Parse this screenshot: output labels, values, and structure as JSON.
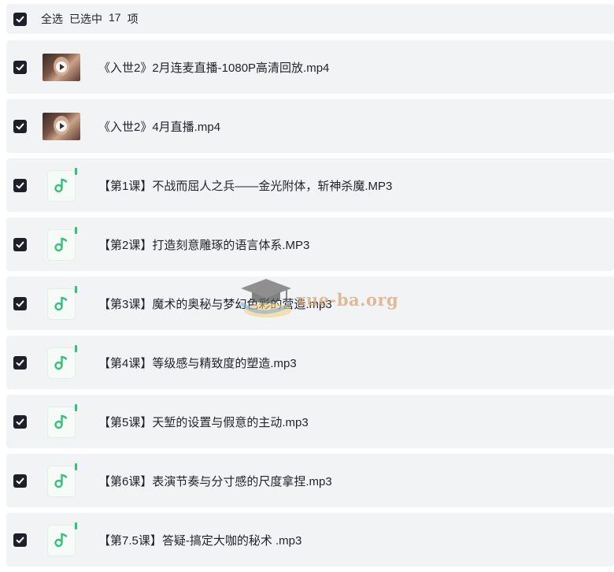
{
  "header": {
    "select_all": "全选",
    "selected_prefix": "已选中",
    "selected_count": "17",
    "selected_suffix": "项"
  },
  "items": [
    {
      "type": "video",
      "icon": "video-thumbnail",
      "title": "《入世2》2月连麦直播-1080P高清回放.mp4"
    },
    {
      "type": "video",
      "icon": "video-thumbnail",
      "title": "《入世2》4月直播.mp4"
    },
    {
      "type": "audio",
      "icon": "music-note-icon",
      "title": "【第1课】不战而屈人之兵——金光附体，斩神杀魔.MP3"
    },
    {
      "type": "audio",
      "icon": "music-note-icon",
      "title": "【第2课】打造刻意雕琢的语言体系.MP3"
    },
    {
      "type": "audio",
      "icon": "music-note-icon",
      "title": "【第3课】魔术的奥秘与梦幻色彩的营造.mp3"
    },
    {
      "type": "audio",
      "icon": "music-note-icon",
      "title": "【第4课】等级感与精致度的塑造.mp3"
    },
    {
      "type": "audio",
      "icon": "music-note-icon",
      "title": "【第5课】天堑的设置与假意的主动.mp3"
    },
    {
      "type": "audio",
      "icon": "music-note-icon",
      "title": "【第6课】表演节奏与分寸感的尺度拿捏.mp3"
    },
    {
      "type": "audio",
      "icon": "music-note-icon",
      "title": "【第7.5课】答疑-搞定大咖的秘术 .mp3"
    }
  ],
  "watermark": {
    "text": "xue-ba.org"
  },
  "colors": {
    "checkbox": "#1e1f2b",
    "row_bg": "#f2f3f5",
    "audio_accent": "#33c27a"
  }
}
